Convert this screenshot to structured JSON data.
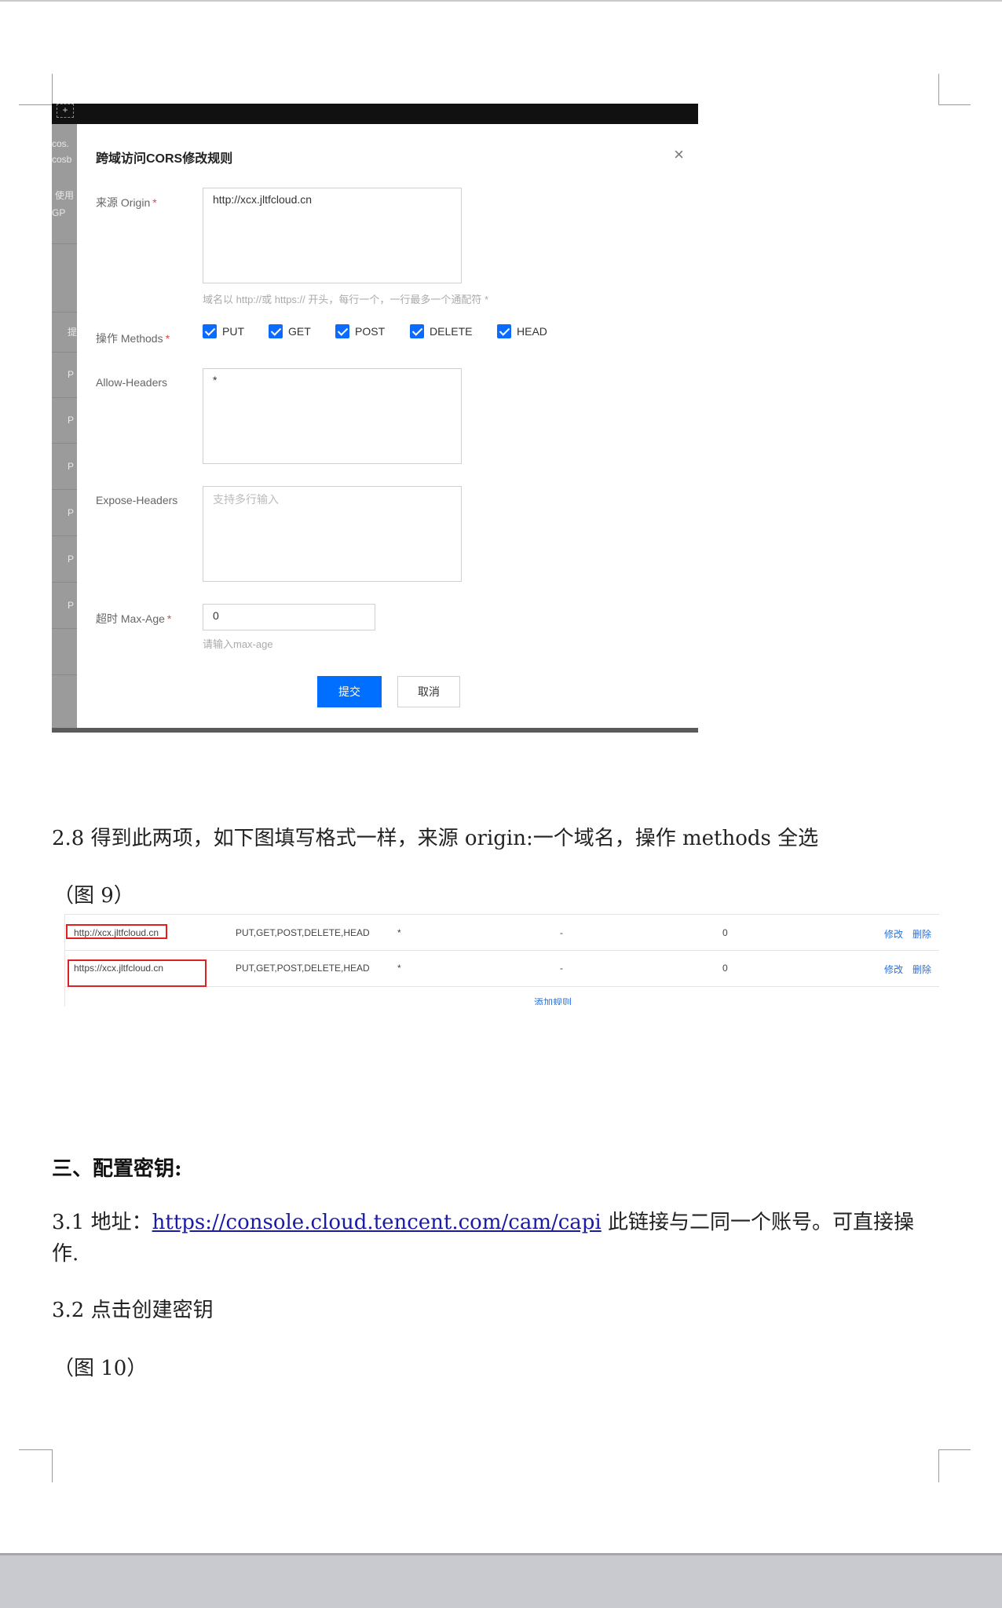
{
  "dialog": {
    "title": "跨域访问CORS修改规则",
    "close_glyph": "×",
    "origin_label": "来源 Origin",
    "origin_value": "http://xcx.jltfcloud.cn",
    "origin_hint": "域名以 http://或 https:// 开头，每行一个，一行最多一个通配符 *",
    "methods_label": "操作 Methods",
    "methods": [
      "PUT",
      "GET",
      "POST",
      "DELETE",
      "HEAD"
    ],
    "allow_headers_label": "Allow-Headers",
    "allow_headers_value": "*",
    "expose_headers_label": "Expose-Headers",
    "expose_headers_placeholder": "支持多行输入",
    "maxage_label": "超时 Max-Age",
    "maxage_value": "0",
    "maxage_hint": "请输入max-age",
    "submit_label": "提交",
    "cancel_label": "取消",
    "required_mark": "*",
    "background_fragments": [
      "cos.",
      "cosb",
      "使用",
      "GP",
      "提",
      "P",
      "P",
      "P",
      "P",
      "P",
      "P"
    ]
  },
  "doc": {
    "p28": "2.8 得到此两项，如下图填写格式一样，来源 origin:一个域名，操作 methods 全选",
    "fig9": "（图 9）",
    "section3": "三、配置密钥:",
    "p31_prefix": "3.1 地址：",
    "p31_link": "https://console.cloud.tencent.com/cam/capi",
    "p31_suffix": " 此链接与二同一个账号。可直接操作.",
    "p32": "3.2 点击创建密钥",
    "fig10": "（图 10）"
  },
  "rules_table": {
    "rows": [
      {
        "origin": "http://xcx.jltfcloud.cn",
        "methods": "PUT,GET,POST,DELETE,HEAD",
        "allow": "*",
        "expose": "-",
        "maxage": "0",
        "edit": "修改",
        "delete": "删除"
      },
      {
        "origin": "https://xcx.jltfcloud.cn",
        "methods": "PUT,GET,POST,DELETE,HEAD",
        "allow": "*",
        "expose": "-",
        "maxage": "0",
        "edit": "修改",
        "delete": "删除"
      }
    ],
    "add_rule": "添加规则",
    "highlight_color": "#e02020"
  }
}
